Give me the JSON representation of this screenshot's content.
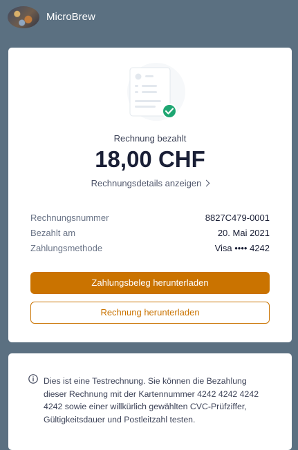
{
  "header": {
    "app_name": "MicroBrew"
  },
  "invoice": {
    "status": "Rechnung bezahlt",
    "amount": "18,00 CHF",
    "details_link": "Rechnungsdetails anzeigen",
    "rows": [
      {
        "label": "Rechnungsnummer",
        "value": "8827C479-0001"
      },
      {
        "label": "Bezahlt am",
        "value": "20. Mai 2021"
      },
      {
        "label": "Zahlungsmethode",
        "value": "Visa •••• 4242"
      }
    ],
    "receipt_button": "Zahlungsbeleg herunterladen",
    "invoice_button": "Rechnung herunterladen"
  },
  "note": {
    "text": "Dies ist eine Testrechnung. Sie können die Bezahlung dieser Rechnung mit der Kartennummer 4242 4242 4242 4242 sowie einer willkürlich gewählten CVC-Prüfziffer, Gültigkeitsdauer und Postleitzahl testen."
  },
  "colors": {
    "background": "#5b7081",
    "accent": "#ca7300",
    "success": "#1ea672"
  }
}
